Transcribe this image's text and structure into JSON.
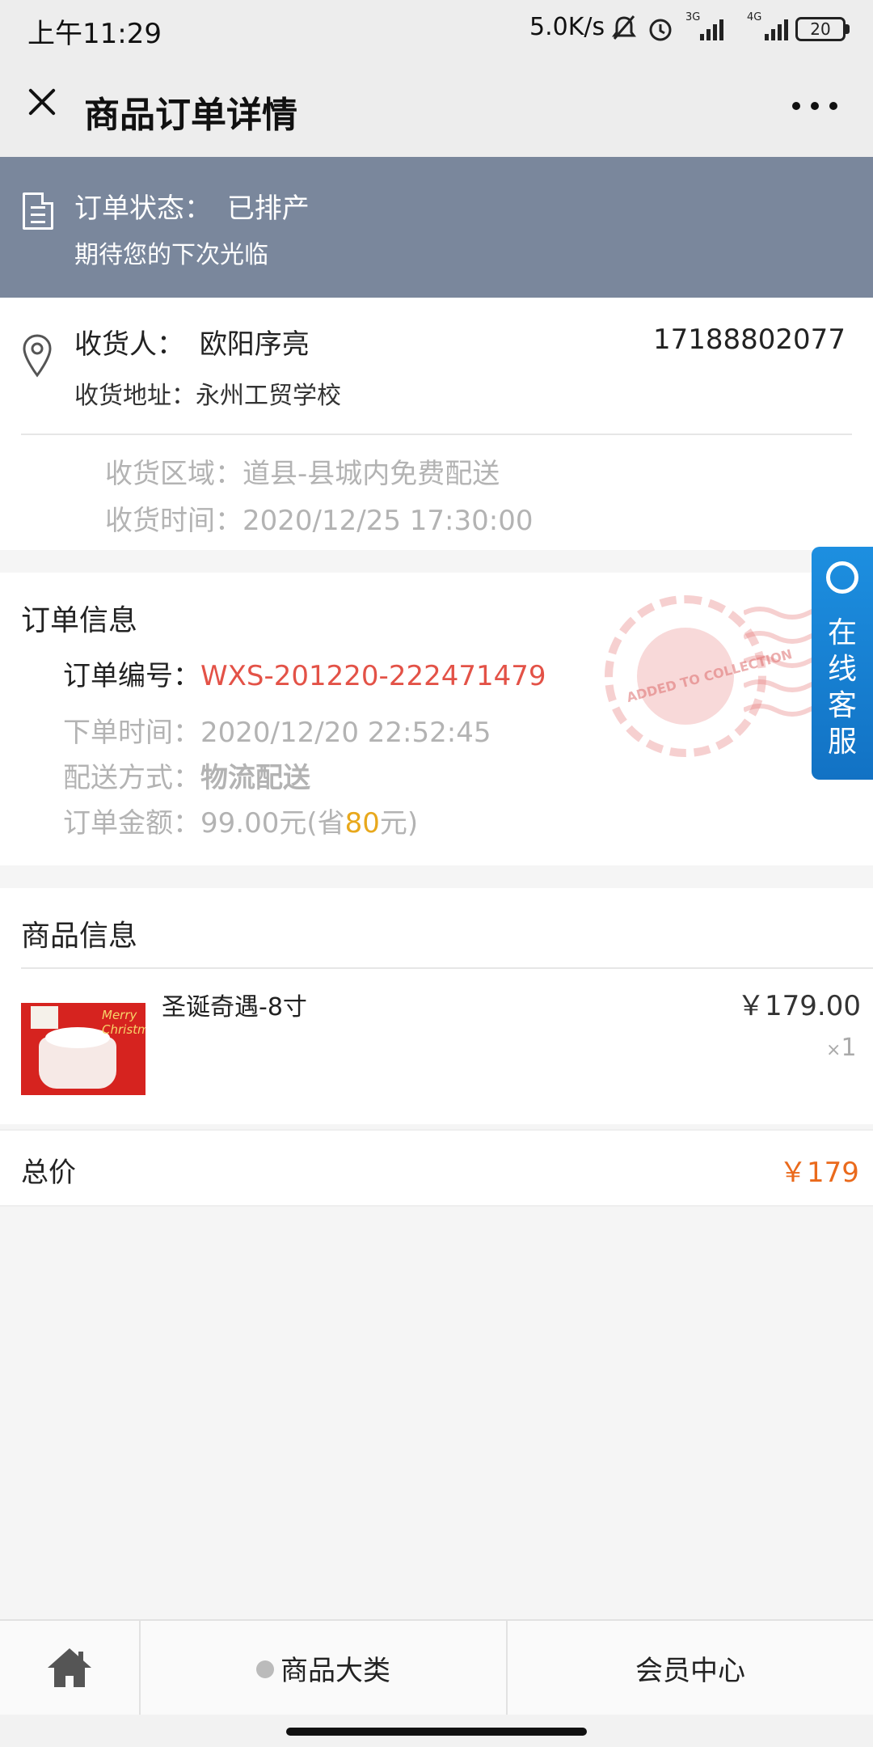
{
  "status_bar": {
    "time": "上午11:29",
    "net_speed": "5.0K/s",
    "signal1_tag": "3G",
    "signal2_tag": "4G",
    "battery": "20"
  },
  "nav": {
    "title": "商品订单详情"
  },
  "order_status": {
    "label": "订单状态：",
    "value": "已排产",
    "message": "期待您的下次光临"
  },
  "receiver": {
    "name_label": "收货人：",
    "name": "欧阳序亮",
    "phone": "17188802077",
    "address_label": "收货地址：",
    "address": "永州工贸学校",
    "region_label": "收货区域：",
    "region": "道县-县城内免费配送",
    "time_label": "收货时间：",
    "time": "2020/12/25 17:30:00"
  },
  "order_info": {
    "title": "订单信息",
    "number_label": "订单编号：",
    "number": "WXS-201220-222471479",
    "time_label": "下单时间：",
    "time": "2020/12/20 22:52:45",
    "shipping_label": "配送方式：",
    "shipping": "物流配送",
    "amount_label": "订单金额：",
    "amount_prefix": "99.00元(省",
    "amount_saved": "80",
    "amount_suffix": "元)",
    "stamp_text": "ADDED TO COLLECTION"
  },
  "customer_service": {
    "label": "在线客服"
  },
  "goods_info": {
    "title": "商品信息",
    "items": [
      {
        "name": "圣诞奇遇-8寸",
        "price": "￥179.00",
        "qty_prefix": "×",
        "qty": "1",
        "image_text": "Merry Christmas"
      }
    ]
  },
  "total": {
    "label": "总价",
    "value": "￥179"
  },
  "tabbar": {
    "tab_categories": "商品大类",
    "tab_member": "会员中心"
  },
  "colors": {
    "status_banner": "#7a879c",
    "order_number": "#e35247",
    "saved_amount": "#e8a81c",
    "total_price": "#ea6a1c",
    "service_button": "#1d8fe0"
  }
}
